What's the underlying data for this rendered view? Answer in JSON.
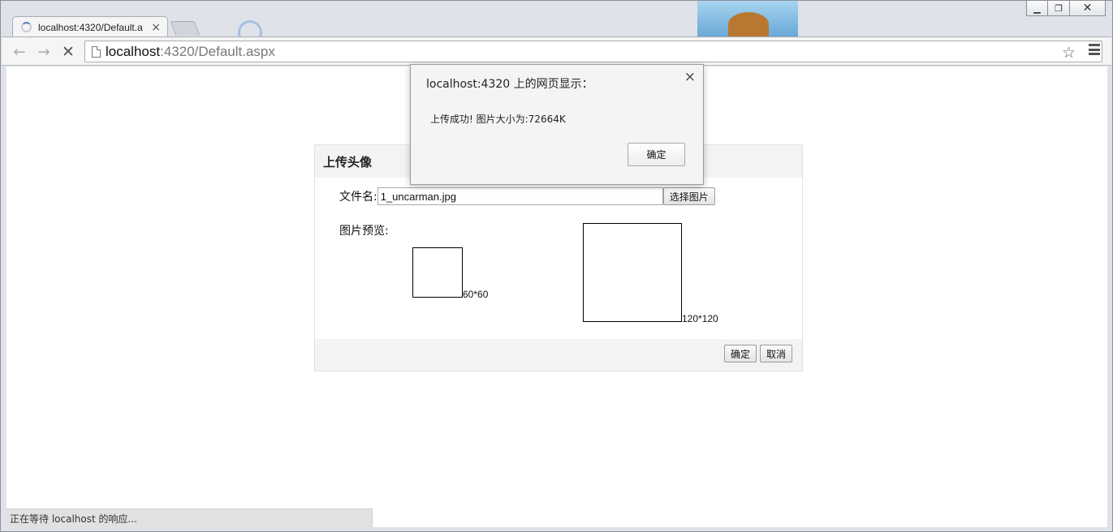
{
  "window": {
    "minimize_icon": "minimize-icon",
    "maximize_icon": "restore-icon",
    "close_icon": "close-icon"
  },
  "tab": {
    "title": "localhost:4320/Default.a",
    "close": "×"
  },
  "address": {
    "host": "localhost",
    "rest": ":4320/Default.aspx"
  },
  "page": {
    "panel_title": "上传头像",
    "file_label": "文件名:",
    "file_value": "1_uncarman.jpg",
    "select_button": "选择图片",
    "preview_label": "图片预览:",
    "small_size": "60*60",
    "large_size": "120*120",
    "ok_button": "确定",
    "cancel_button": "取消"
  },
  "status": {
    "text": "正在等待 localhost 的响应..."
  },
  "dialog": {
    "title": "localhost:4320 上的网页显示：",
    "message": "上传成功! 图片大小为:72664K",
    "ok": "确定",
    "close": "×"
  }
}
